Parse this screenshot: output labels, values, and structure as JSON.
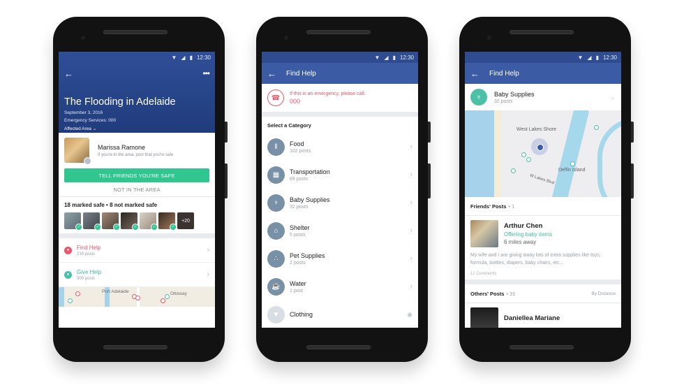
{
  "colors": {
    "brand_blue": "#3b5ca5",
    "safe_green": "#2fc68f",
    "alert_red": "#e8556d",
    "teal": "#4cc1a8",
    "category_icon": "#7891a6"
  },
  "status_bar": {
    "time": "12:30",
    "icons": [
      "wifi-icon",
      "signal-icon",
      "battery-icon"
    ]
  },
  "phone1": {
    "event_title": "The Flooding in Adelaide",
    "date": "September 3, 2016",
    "emergency_services": "Emergency Services: 000",
    "affected_area": "Affected Area",
    "user_name": "Marissa Ramone",
    "user_prompt": "If you're in the area, post that you're safe",
    "safe_button": "TELL FRIENDS YOU'RE SAFE",
    "not_in_area_button": "NOT IN THE AREA",
    "marked_summary": "18 marked safe • 8 not marked safe",
    "more_friends": "+20",
    "find_help": {
      "label": "Find Help",
      "posts": "218 posts"
    },
    "give_help": {
      "label": "Give Help",
      "posts": "300 posts"
    },
    "map_labels": [
      "Port Adelaide",
      "Ottoway"
    ]
  },
  "phone2": {
    "title": "Find Help",
    "emergency_text": "If this is an emergency, please call:",
    "emergency_number": "000",
    "section_label": "Select a Category",
    "categories": [
      {
        "label": "Food",
        "posts": "102 posts",
        "icon": "utensils-icon"
      },
      {
        "label": "Transportation",
        "posts": "89 posts",
        "icon": "bus-icon"
      },
      {
        "label": "Baby Supplies",
        "posts": "32 posts",
        "icon": "stroller-icon"
      },
      {
        "label": "Shelter",
        "posts": "5 posts",
        "icon": "home-icon"
      },
      {
        "label": "Pet Supplies",
        "posts": "2 posts",
        "icon": "paw-icon"
      },
      {
        "label": "Water",
        "posts": "1 post",
        "icon": "cup-icon"
      },
      {
        "label": "Clothing",
        "posts": "",
        "icon": "shirt-icon"
      }
    ]
  },
  "phone3": {
    "title": "Find Help",
    "category": "Baby Supplies",
    "category_posts": "32 posts",
    "map_labels": [
      "West Lakes Shore",
      "Delfin Island",
      "W Lakes Blvd"
    ],
    "friends_posts_label": "Friends' Posts",
    "friends_posts_count": "• 1",
    "post": {
      "name": "Arthur Chen",
      "offer": "Offering baby items",
      "distance": "6 miles away",
      "body": "My wife and I are giving away lots of extra supplies like toys, formula, bottles, diapers, baby chairs, etc...",
      "comments": "12 Comments"
    },
    "others_posts_label": "Others' Posts",
    "others_posts_count": "• 31",
    "sort_label": "By Distance",
    "other_name": "Daniellea Mariane"
  }
}
